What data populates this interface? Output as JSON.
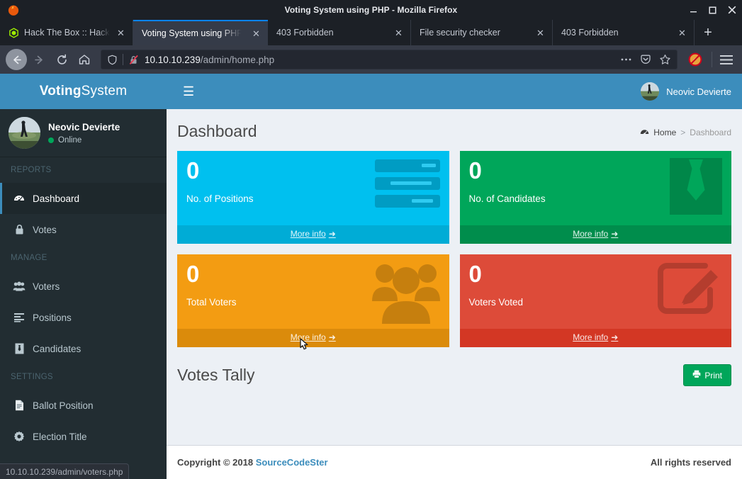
{
  "browser": {
    "window_title": "Voting System using PHP - Mozilla Firefox",
    "logo_icon": "firefox-logo",
    "window_controls": [
      {
        "name": "minimize",
        "icon": "minimize-icon"
      },
      {
        "name": "maximize",
        "icon": "maximize-icon"
      },
      {
        "name": "close",
        "icon": "close-icon"
      }
    ],
    "tabs": [
      {
        "title": "Hack The Box :: Hack T",
        "favicon": "hackthebox-icon",
        "active": false
      },
      {
        "title": "Voting System using PHP",
        "favicon": "",
        "active": true
      },
      {
        "title": "403 Forbidden",
        "favicon": "",
        "active": false
      },
      {
        "title": "File security checker",
        "favicon": "",
        "active": false
      },
      {
        "title": "403 Forbidden",
        "favicon": "",
        "active": false
      }
    ],
    "new_tab_label": "+",
    "nav": {
      "back_icon": "back-arrow-icon",
      "forward_icon": "forward-arrow-icon",
      "reload_icon": "reload-icon",
      "home_icon": "home-icon"
    },
    "url": {
      "host": "10.10.10.239",
      "path": "/admin/home.php",
      "shield_icon": "shield-icon",
      "lock_icon": "insecure-lock-icon"
    },
    "url_actions": [
      {
        "name": "page-actions",
        "icon": "ellipsis-icon"
      },
      {
        "name": "pocket",
        "icon": "pocket-icon"
      },
      {
        "name": "bookmark",
        "icon": "star-icon"
      }
    ],
    "extension_icon": "noscript-icon",
    "menu_icon": "hamburger-menu-icon",
    "status_bar": "10.10.10.239/admin/voters.php"
  },
  "sidebar": {
    "brand_bold": "Voting",
    "brand_light": "System",
    "user": {
      "name": "Neovic Devierte",
      "status": "Online",
      "avatar": "user-avatar-photo"
    },
    "sections": [
      {
        "header": "REPORTS",
        "items": [
          {
            "label": "Dashboard",
            "icon": "tachometer-icon",
            "active": true
          },
          {
            "label": "Votes",
            "icon": "lock-icon",
            "active": false
          }
        ]
      },
      {
        "header": "MANAGE",
        "items": [
          {
            "label": "Voters",
            "icon": "users-icon",
            "active": false
          },
          {
            "label": "Positions",
            "icon": "align-left-icon",
            "active": false
          },
          {
            "label": "Candidates",
            "icon": "user-tie-icon",
            "active": false
          }
        ]
      },
      {
        "header": "SETTINGS",
        "items": [
          {
            "label": "Ballot Position",
            "icon": "file-text-icon",
            "active": false
          },
          {
            "label": "Election Title",
            "icon": "gear-icon",
            "active": false
          }
        ]
      }
    ]
  },
  "topbar": {
    "menu_toggle_icon": "hamburger-icon",
    "user_name": "Neovic Devierte",
    "avatar": "user-avatar-photo"
  },
  "main": {
    "page_title": "Dashboard",
    "breadcrumb": {
      "home_icon": "tachometer-icon",
      "home": "Home",
      "separator": ">",
      "current": "Dashboard"
    },
    "cards": [
      {
        "value": "0",
        "label": "No. of Positions",
        "more": "More info",
        "icon": "tasks-icon",
        "color": "#00c0ef"
      },
      {
        "value": "0",
        "label": "No. of Candidates",
        "more": "More info",
        "icon": "user-tie-icon",
        "color": "#00a65a"
      },
      {
        "value": "0",
        "label": "Total Voters",
        "more": "More info",
        "icon": "users-icon",
        "color": "#f39c12"
      },
      {
        "value": "0",
        "label": "Voters Voted",
        "more": "More info",
        "icon": "edit-square-icon",
        "color": "#dd4b39"
      }
    ],
    "tally": {
      "title": "Votes Tally",
      "print_label": "Print",
      "print_icon": "printer-icon"
    }
  },
  "footer": {
    "copyright_prefix": "Copyright © 2018",
    "brand_link": "SourceCodeSter",
    "rights": "All rights reserved"
  },
  "colors": {
    "brand_blue": "#3c8dbc",
    "sidebar_dark": "#222d32",
    "aqua": "#00c0ef",
    "green": "#00a65a",
    "yellow": "#f39c12",
    "red": "#dd4b39"
  }
}
